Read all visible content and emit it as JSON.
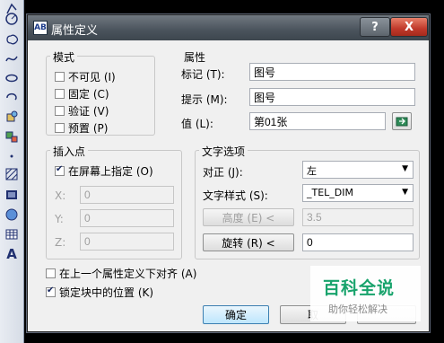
{
  "toolbar": {
    "icons": [
      "polyline-icon",
      "circle-icon",
      "revcloud-icon",
      "spline-icon",
      "ellipse-icon",
      "ellipse-arc-icon",
      "insert-block-icon",
      "make-block-icon",
      "point-icon",
      "hatch-icon",
      "gradient-icon",
      "region-icon",
      "table-icon",
      "multiline-text-icon"
    ],
    "text_tool_label": "A"
  },
  "dialog": {
    "title": "属性定义",
    "icon_text": "AB",
    "help_label": "?",
    "close_label": "X"
  },
  "mode": {
    "title": "模式",
    "items": [
      {
        "label": "不可见 (I)",
        "checked": false
      },
      {
        "label": "固定 (C)",
        "checked": false
      },
      {
        "label": "验证 (V)",
        "checked": false
      },
      {
        "label": "预置 (P)",
        "checked": false
      }
    ]
  },
  "attribute": {
    "title": "属性",
    "tag_label": "标记 (T):",
    "tag_value": "图号",
    "prompt_label": "提示 (M):",
    "prompt_value": "图号",
    "value_label": "值 (L):",
    "value_value": "第01张"
  },
  "insertion_point": {
    "title": "插入点",
    "specify_on_screen_label": "在屏幕上指定 (O)",
    "specify_on_screen_checked": true,
    "x_label": "X:",
    "x_value": "0",
    "y_label": "Y:",
    "y_value": "0",
    "z_label": "Z:",
    "z_value": "0"
  },
  "text_options": {
    "title": "文字选项",
    "justify_label": "对正 (J):",
    "justify_value": "左",
    "style_label": "文字样式 (S):",
    "style_value": "_TEL_DIM",
    "height_label": "高度 (E) <",
    "height_value": "3.5",
    "rotation_label": "旋转 (R) <",
    "rotation_value": "0"
  },
  "align_below_label": "在上一个属性定义下对齐 (A)",
  "align_below_checked": false,
  "lock_position_label": "锁定块中的位置 (K)",
  "lock_position_checked": true,
  "buttons": {
    "ok": "确定",
    "cancel": "取"
  },
  "watermark": {
    "title": "百科全说",
    "subtitle": "助你轻松解决"
  }
}
